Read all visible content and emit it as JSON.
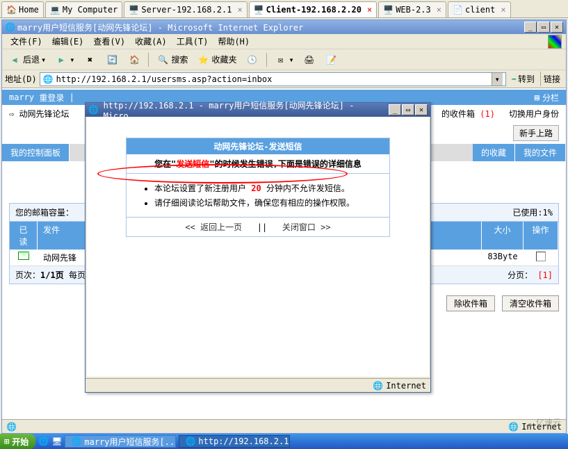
{
  "top_tabs": [
    {
      "label": "Home",
      "icon": "🏠"
    },
    {
      "label": "My Computer",
      "icon": "💻"
    },
    {
      "label": "Server-192.168.2.1",
      "icon": "🖥️"
    },
    {
      "label": "Client-192.168.2.20",
      "icon": "🖥️",
      "active": true
    },
    {
      "label": "WEB-2.3",
      "icon": "🖥️"
    },
    {
      "label": "client",
      "icon": "📄"
    }
  ],
  "ie": {
    "title": "marry用户短信服务[动网先锋论坛] - Microsoft Internet Explorer",
    "menus": {
      "file": "文件(F)",
      "edit": "编辑(E)",
      "view": "查看(V)",
      "fav": "收藏(A)",
      "tools": "工具(T)",
      "help": "帮助(H)"
    },
    "toolbar": {
      "back": "后退",
      "search": "搜索",
      "favorites": "收藏夹"
    },
    "address": {
      "label": "地址(D)",
      "url": "http://192.168.2.1/usersms.asp?action=inbox",
      "go": "转到",
      "links": "链接"
    },
    "status_zone": "Internet"
  },
  "page": {
    "user": "marry",
    "relogin": "重登录",
    "split": "分栏",
    "forum_name": "动网先锋论坛",
    "inbox_suffix": "的收件箱",
    "inbox_count": "(1)",
    "switch_user": "切换用户身份",
    "newbie": "新手上路",
    "tabs": {
      "control": "我的控制面板",
      "fav": "的收藏",
      "files": "我的文件"
    },
    "mailbox": {
      "quota_label": "您的邮箱容量：",
      "used_label": "已使用:",
      "used_val": "1%"
    },
    "table": {
      "read": "已读",
      "sender": "发件",
      "size": "大小",
      "action": "操作",
      "sender_val": "动网先锋",
      "size_val": "83Byte"
    },
    "footer": {
      "pages_label": "页次：",
      "pages_val": "1/1页",
      "per_label": "每页",
      "page_links_label": "分页：",
      "page_links": "[1]"
    },
    "buttons": {
      "delete": "除收件箱",
      "clear": "清空收件箱"
    }
  },
  "popup": {
    "title": "http://192.168.2.1 - marry用户短信服务[动网先锋论坛] - Micro...",
    "box_title": "动网先锋论坛-发送短信",
    "subtitle_pre": "您在\"",
    "subtitle_red": "发送短信",
    "subtitle_post": "\"的时候发生错误,下面是错误的详细信息",
    "bullet1_pre": "本论坛设置了新注册用户 ",
    "bullet1_num": "20",
    "bullet1_post": " 分钟内不允许发短信。",
    "bullet2": "请仔细阅读论坛帮助文件，确保您有相应的操作权限。",
    "back_link": "<< 返回上一页",
    "sep": "||",
    "close_link": "关闭窗口 >>",
    "status_zone": "Internet"
  },
  "taskbar": {
    "start": "开始",
    "items": [
      {
        "label": "marry用户短信服务[...",
        "icon": "🌐"
      },
      {
        "label": "http://192.168.2.1 ...",
        "icon": "🌐",
        "active": true
      }
    ]
  },
  "watermark": "亿速云"
}
